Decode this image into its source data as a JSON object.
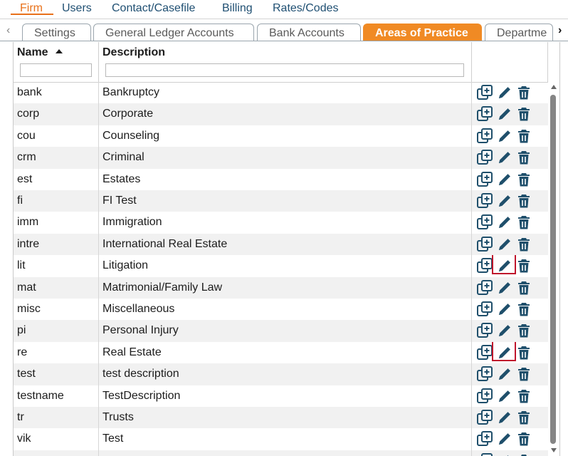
{
  "topnav": {
    "items": [
      "Firm",
      "Users",
      "Contact/Casefile",
      "Billing",
      "Rates/Codes"
    ],
    "active": "Firm"
  },
  "tabs": {
    "items": [
      "Settings",
      "General Ledger Accounts",
      "Bank Accounts",
      "Areas of Practice",
      "Departme"
    ],
    "active": "Areas of Practice"
  },
  "icons": {
    "prev": "chevron-left-icon",
    "next": "chevron-right-icon",
    "copy": "copy-add-icon",
    "edit": "pencil-icon",
    "delete": "trash-icon"
  },
  "table": {
    "columns": [
      "Name",
      "Description"
    ],
    "sort": {
      "column": "Name",
      "direction": "ascending"
    },
    "rows": [
      {
        "name": "bank",
        "description": "Bankruptcy"
      },
      {
        "name": "corp",
        "description": "Corporate"
      },
      {
        "name": "cou",
        "description": "Counseling"
      },
      {
        "name": "crm",
        "description": "Criminal"
      },
      {
        "name": "est",
        "description": "Estates"
      },
      {
        "name": "fi",
        "description": "FI Test"
      },
      {
        "name": "imm",
        "description": "Immigration"
      },
      {
        "name": "intre",
        "description": "International Real Estate"
      },
      {
        "name": "lit",
        "description": "Litigation",
        "edit_highlighted": true
      },
      {
        "name": "mat",
        "description": "Matrimonial/Family Law"
      },
      {
        "name": "misc",
        "description": "Miscellaneous"
      },
      {
        "name": "pi",
        "description": "Personal Injury"
      },
      {
        "name": "re",
        "description": "Real Estate",
        "edit_highlighted": true
      },
      {
        "name": "test",
        "description": "test description"
      },
      {
        "name": "testname",
        "description": "TestDescription"
      },
      {
        "name": "tr",
        "description": "Trusts"
      },
      {
        "name": "vik",
        "description": "Test"
      },
      {
        "name": "",
        "description": ""
      }
    ]
  },
  "colors": {
    "accent": "#f08a24",
    "nav_text": "#1f4f72",
    "icon": "#1f4f6b",
    "highlight": "#c0152c",
    "alt_row": "#f1f1f1"
  }
}
